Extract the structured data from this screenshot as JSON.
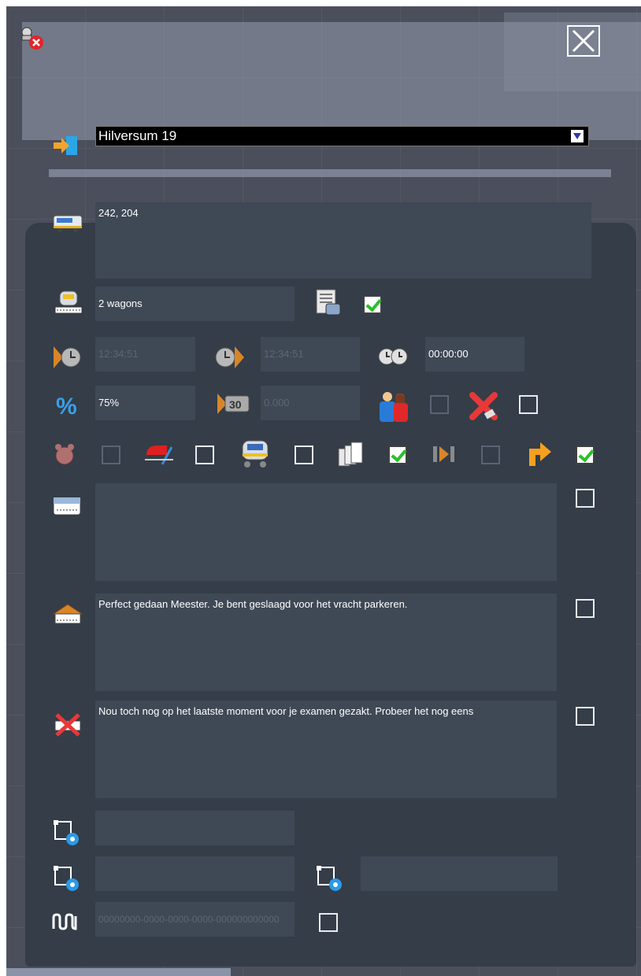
{
  "header": {
    "station_dropdown_value": "Hilversum 19"
  },
  "train": {
    "ids": "242, 204",
    "wagons": "2 wagons",
    "wagons_checkbox_checked": true
  },
  "times": {
    "arrival": "12:34:51",
    "departure": "12:34:51",
    "duration": "00:00:00"
  },
  "load": {
    "percent": "75%",
    "speed_value": "0.000",
    "passenger_checkbox_checked": false,
    "cancel_checkbox_checked": false
  },
  "options": [
    {
      "name": "alarm",
      "checked": false
    },
    {
      "name": "coupling",
      "checked": false
    },
    {
      "name": "train-wash",
      "checked": false
    },
    {
      "name": "documents",
      "checked": true
    },
    {
      "name": "skip",
      "checked": false
    },
    {
      "name": "exit",
      "checked": true
    }
  ],
  "messages": {
    "start_text": "",
    "start_checked": false,
    "success_text": "Perfect gedaan Meester. Je bent geslaagd voor het vracht parkeren.",
    "success_checked": false,
    "fail_text": "Nou toch nog op het laatste moment voor je examen gezakt. Probeer het nog eens",
    "fail_checked": false
  },
  "scripts": {
    "script1": "",
    "script2": "",
    "script3": ""
  },
  "signal": {
    "guid": "00000000-0000-0000-0000-000000000000",
    "checked": false
  },
  "colors": {
    "accent_orange": "#f0a020",
    "check_green": "#28c02a",
    "panel": "#343d48",
    "field": "#3f4855"
  }
}
